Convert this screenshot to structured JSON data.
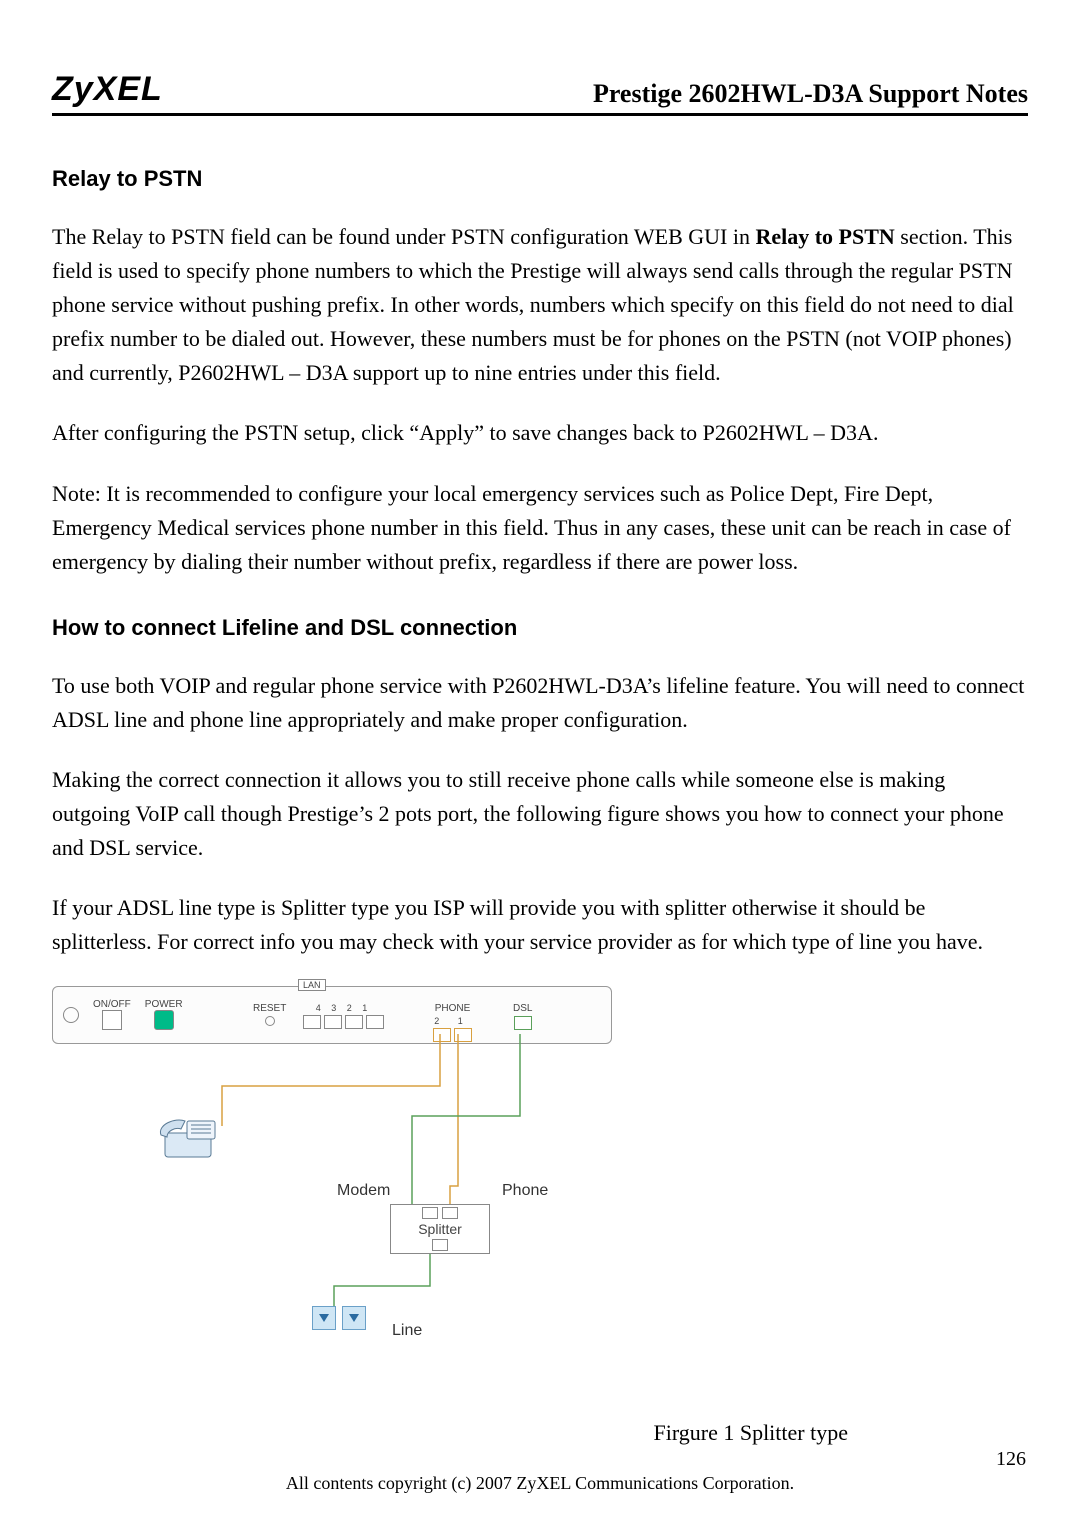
{
  "header": {
    "logo": "ZyXEL",
    "title": "Prestige 2602HWL-D3A Support Notes"
  },
  "sections": {
    "relay_heading": "Relay to PSTN",
    "lifeline_heading": "How to connect Lifeline and DSL connection"
  },
  "para": {
    "p1_part1": "The Relay to PSTN field can be found under PSTN configuration WEB GUI in ",
    "p1_bold": "Relay to PSTN",
    "p1_part2": " section. This field is used to specify phone numbers to which the Prestige will always send calls through the regular PSTN phone service without pushing prefix. In other words, numbers which specify on this field do not need to dial prefix number to be dialed out. However, these numbers must be for phones on the PSTN (not VOIP phones) and currently, P2602HWL – D3A support up to nine entries under this field.",
    "p2": "After configuring the PSTN setup, click “Apply” to save changes back to P2602HWL – D3A.",
    "p3": "Note: It is recommended to configure your local emergency services such as Police Dept, Fire Dept, Emergency Medical services phone number in this field. Thus in any cases, these unit can be reach in case of emergency by dialing their number without prefix, regardless if there are power loss.",
    "p4": "To use both VOIP and regular phone service with P2602HWL-D3A’s lifeline feature. You will need to connect ADSL line and phone line appropriately and make proper configuration.",
    "p5": "Making the correct connection it allows you to still receive phone calls while someone else is making outgoing VoIP call though Prestige’s 2 pots port, the following figure shows you how to connect your phone and DSL service.",
    "p6": "If your ADSL line type is Splitter type you ISP will provide you with splitter otherwise it should be splitterless. For correct info you may check with your service provider as for which type of line you have."
  },
  "diagram": {
    "router": {
      "onoff": "ON/OFF",
      "power": "POWER",
      "reset": "RESET",
      "lan": "LAN",
      "lan_nums": "4  3  2  1",
      "phone": "PHONE",
      "phone_nums": "2  1",
      "dsl": "DSL"
    },
    "labels": {
      "modem": "Modem",
      "phone": "Phone",
      "splitter": "Splitter",
      "line": "Line"
    }
  },
  "figure_caption": "Firgure 1 Splitter type",
  "page_number": "126",
  "footer": "All contents copyright (c) 2007 ZyXEL Communications Corporation."
}
